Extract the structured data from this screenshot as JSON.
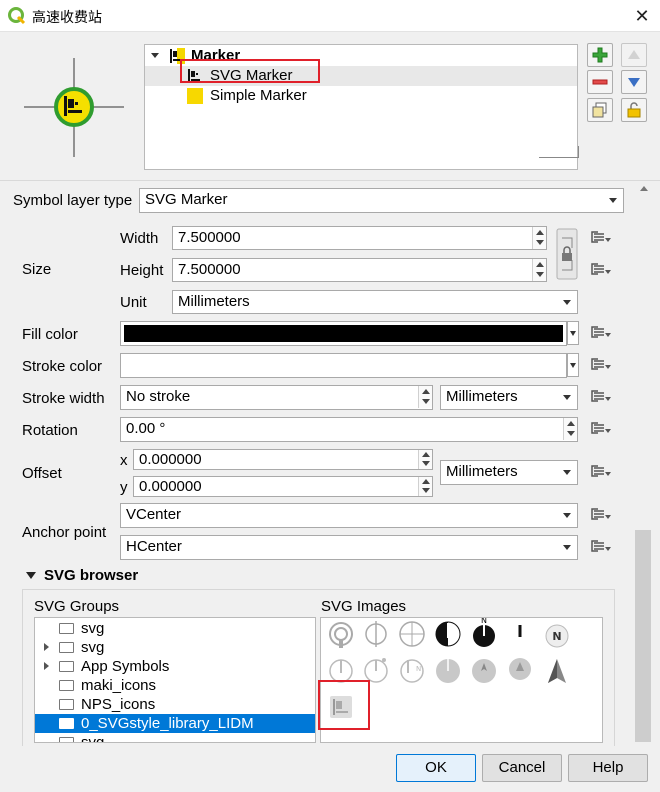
{
  "window": {
    "title": "高速收费站",
    "close_glyph": "✕"
  },
  "layer_tree": {
    "items": [
      {
        "label": "Marker"
      },
      {
        "label": "SVG Marker"
      },
      {
        "label": "Simple Marker"
      }
    ]
  },
  "symbol_layer_type": {
    "label": "Symbol layer type",
    "value": "SVG Marker"
  },
  "size": {
    "group_label": "Size",
    "width_label": "Width",
    "width_value": "7.500000",
    "height_label": "Height",
    "height_value": "7.500000",
    "unit_label": "Unit",
    "unit_value": "Millimeters"
  },
  "fill_color": {
    "label": "Fill color",
    "color": "#000000"
  },
  "stroke_color": {
    "label": "Stroke color",
    "color": "#ffffff"
  },
  "stroke_width": {
    "label": "Stroke width",
    "value": "No stroke",
    "unit": "Millimeters"
  },
  "rotation": {
    "label": "Rotation",
    "value": "0.00 °"
  },
  "offset": {
    "label": "Offset",
    "x_label": "x",
    "x_value": "0.000000",
    "y_label": "y",
    "y_value": "0.000000",
    "unit": "Millimeters"
  },
  "anchor_point": {
    "label": "Anchor point",
    "vertical": "VCenter",
    "horizontal": "HCenter"
  },
  "svg_browser": {
    "title": "SVG browser",
    "groups_label": "SVG Groups",
    "images_label": "SVG Images",
    "groups": [
      {
        "label": "svg",
        "expandable": false,
        "selected": false
      },
      {
        "label": "svg",
        "expandable": true,
        "selected": false
      },
      {
        "label": "App Symbols",
        "expandable": true,
        "selected": false
      },
      {
        "label": "maki_icons",
        "expandable": false,
        "selected": false
      },
      {
        "label": "NPS_icons",
        "expandable": false,
        "selected": false
      },
      {
        "label": "0_SVGstyle_library_LIDM",
        "expandable": false,
        "selected": true
      },
      {
        "label": "svg",
        "expandable": false,
        "selected": false
      }
    ]
  },
  "buttons": {
    "ok": "OK",
    "cancel": "Cancel",
    "help": "Help"
  },
  "colors": {
    "accent_select": "#0078d7",
    "highlight_box": "#e0202a",
    "add_green": "#2e9a2e",
    "remove_red": "#d03030",
    "move_blue": "#3a6fc4",
    "lock_yellow": "#f2c200"
  }
}
